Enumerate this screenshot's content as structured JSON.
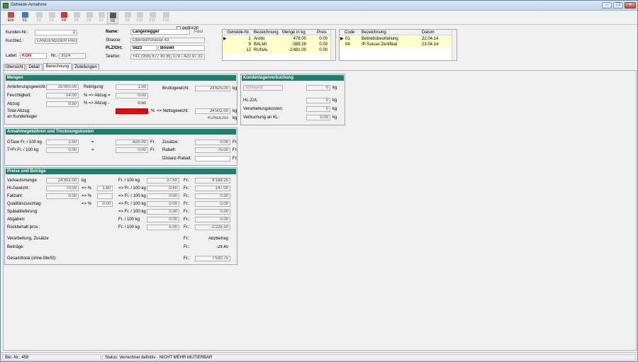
{
  "window": {
    "title": "Getreide-Annahme"
  },
  "toolbar": {
    "buttons": [
      {
        "key": "exit",
        "label": "Exit",
        "icon": "exit-icon",
        "color": "#d04a3b",
        "enabled": true
      },
      {
        "key": "f1",
        "label": "F1",
        "icon": "form-icon",
        "color": "#3c7bbd",
        "enabled": true
      },
      {
        "key": "f2",
        "label": "F2",
        "icon": "document-icon",
        "color": "#cfcfcf",
        "enabled": false
      },
      {
        "key": "f3",
        "label": "F3",
        "icon": "document-icon",
        "color": "#cfcfcf",
        "enabled": false
      },
      {
        "key": "f4",
        "label": "F4",
        "icon": "refresh-icon",
        "color": "#d6352b",
        "enabled": true
      },
      {
        "key": "f5",
        "label": "F5",
        "icon": "edit-icon",
        "color": "#cfcfcf",
        "enabled": false
      },
      {
        "key": "f6",
        "label": "F6",
        "icon": "document-icon",
        "color": "#cfcfcf",
        "enabled": false
      },
      {
        "key": "f7",
        "label": "F7",
        "icon": "document-icon",
        "color": "#cfcfcf",
        "enabled": false
      },
      {
        "key": "f8",
        "label": "F8",
        "icon": "printer-icon",
        "color": "#555555",
        "enabled": true
      },
      {
        "key": "f9",
        "label": "F9",
        "icon": "document-icon",
        "color": "#cfcfcf",
        "enabled": false
      },
      {
        "key": "f10",
        "label": "F10",
        "icon": "document-icon",
        "color": "#cfcfcf",
        "enabled": false
      },
      {
        "key": "f11",
        "label": "F11",
        "icon": "document-icon",
        "color": "#cfcfcf",
        "enabled": false
      },
      {
        "key": "f12",
        "label": "F12",
        "icon": "document-icon",
        "color": "#cfcfcf",
        "enabled": false
      }
    ],
    "gedruckt_label": "gedruckt"
  },
  "header": {
    "kunden_nr_label": "Kunden-Nr.:",
    "kunden_nr": "1",
    "kurzbez_label": "Kurzbez.:",
    "kurzbez": "LANGENGGER PAUL",
    "label_label": "Label:",
    "label_value": "KON",
    "nr_label": "Nr.:",
    "nr_value": "3524",
    "name_label": "Name:",
    "name": "Langenegger",
    "name_prefix": "Paul",
    "strasse_label": "Strasse:",
    "strasse": "Oberdorfstrasse 43",
    "plz_label": "PLZ/Ort:",
    "plz": "5623",
    "ort": "Boswil",
    "telefon_label": "Telefon:",
    "telefon": "+41 (056) 677 80 85",
    "telefon2": "079 / 420 97 31"
  },
  "getreide_table": {
    "headers": [
      "Getreide-Nr.",
      "Bezeichnung",
      "Menge in kg",
      "Preis"
    ],
    "rows": [
      [
        "1",
        "Arollo",
        "478.00",
        "0.00"
      ],
      [
        "9",
        "BALMI",
        "-389.29",
        "0.00"
      ],
      [
        "12",
        "RUNAL",
        "-2'481.00",
        "0.00"
      ]
    ]
  },
  "code_table": {
    "headers": [
      "Code",
      "Bezeichnung",
      "Datum"
    ],
    "rows": [
      [
        "01",
        "Betriebsbeurteilung",
        "22.04.14"
      ],
      [
        "04",
        "IP-Suisse Zertifikat",
        "23.04.14"
      ]
    ]
  },
  "tabs": [
    "Übersicht",
    "Detail",
    "Berechnung",
    "Zuteilungen"
  ],
  "mengen": {
    "title": "Mengen",
    "anlief_label": "Anlieferungsgewicht:",
    "anlief": "25'000.00",
    "feucht_label": "Feuchtigkeit:",
    "feucht": "14.00",
    "abzug_label": "Abzug:",
    "abzug": "0.50",
    "total_abzug_label": "Total Abzug:",
    "kundenlager_label": "an Kundenlager",
    "reinigung_label": "Reinigung:",
    "reinigung": "1.50",
    "pct_abzug_label": "% => Abzug =",
    "pct_abzug": "0.00",
    "pct_abzug2_label": "% => Abzug -",
    "pct_abzug2": "0.50",
    "red_value": "0.00",
    "pct_label": "%",
    "netto_label": "=> Nettogewicht:",
    "netto": "24'502.00",
    "kundlag": "KUNDLAG",
    "brutto_label": "Bruttogewicht:",
    "brutto": "24'625.00",
    "kg": "kg"
  },
  "annahme": {
    "title": "Annahmegebühren und Trocknungskosten",
    "gtaxe_label": "GTaxe Fr. / 100 kg",
    "gtaxe": "2.50",
    "eq": "=",
    "gtaxe_val": "-625.00",
    "fr": "Fr.",
    "tfr_label": "T+Fr.Fr. / 100 kg",
    "tfr": "0.00",
    "eq2": "=",
    "tfr_val": "0.00",
    "zusatz_label": "Zusätze:",
    "zusatz": "0.00",
    "rabatt_label": "Rabatt:",
    "rabatt": "75.00",
    "distanz_label": "Distanz-Rabatt:",
    "distanz": ""
  },
  "preise": {
    "title": "Preise und Beträge",
    "rows": [
      {
        "label": "Verkaufsmenge:",
        "v1": "24'502.00",
        "u1": "kg",
        "pct": "",
        "v2": "",
        "unit": "Fr. / 100 kg",
        "v3": "37.50",
        "fr": "Fr.:",
        "v4": "9'188.25"
      },
      {
        "label": "Hl-Gewicht:",
        "v1": "70.00",
        "u1": "=> %",
        "pct": "1.60",
        "v2": "",
        "unit": "=> Fr. / 100 kg",
        "v3": "0.60",
        "fr": "Fr.:",
        "v4": "147.00"
      },
      {
        "label": "Fallzahl:",
        "v1": "0.00",
        "u1": "=> %",
        "pct": "",
        "v2": "",
        "unit": "=> Fr. / 100 kg",
        "v3": "0.00",
        "fr": "Fr.:",
        "v4": "0.00"
      },
      {
        "label": "Qualitätszuschlag:",
        "v1": "",
        "u1": "=> %",
        "pct": "0.00",
        "v2": "",
        "unit": "=> Fr. / 100 kg",
        "v3": "0.00",
        "fr": "Fr.:",
        "v4": "0.00"
      },
      {
        "label": "Spätablieferung:",
        "v1": "",
        "u1": "",
        "pct": "",
        "v2": "",
        "unit": "=> Fr. / 100 kg",
        "v3": "0.00",
        "fr": "Fr.:",
        "v4": "0.00"
      },
      {
        "label": "Abgaben:",
        "v1": "",
        "u1": "",
        "pct": "",
        "v2": "",
        "unit": "Fr. / 100 kg",
        "v3": "0.00",
        "fr": "Fr.:",
        "v4": "0.00"
      },
      {
        "label": "Rückbehalt prov.:",
        "v1": "",
        "u1": "",
        "pct": "",
        "v2": "",
        "unit": "Fr. / 100 kg",
        "v3": "5.00",
        "fr": "Fr.:",
        "v4": "-1'225.10"
      }
    ],
    "verarbeitung_label": "Verarbeitung, Zusätze",
    "verarbeitung_fr": "Fr.:",
    "verarbeitung_val": "AbzBetrag",
    "beitraege_label": "Beiträge:",
    "beitraege_fr": "Fr.:",
    "beitraege_val": "-29.40",
    "gesamt_label": "Gesamttotal (ohne MwSt):",
    "gesamt_fr": "Fr.:",
    "gesamt_val": "7'530.75"
  },
  "kunden": {
    "title": "Kundenlagerverbuchung",
    "schwund_placeholder": "Schwund",
    "schwund": "0",
    "kg": "kg",
    "hlza_label": "HL-Z/A:",
    "hlza": "0",
    "verarb_label": "Verarbeitungskosten:",
    "verarb": "0",
    "verbuch_label": "Verbuchung an KL:",
    "verbuch": "0.00"
  },
  "status": {
    "belnr_label": "Bel.-Nr.:",
    "belnr": "458",
    "status_label": "Status:",
    "status_text": "Verrechnet definitiv - NICHT MEHR MUTIERBAR"
  },
  "colors": {
    "accent": "#1d7f72",
    "warning": "#ff0000",
    "highlight": "#ffffcc",
    "label_red": "#ff0000"
  }
}
